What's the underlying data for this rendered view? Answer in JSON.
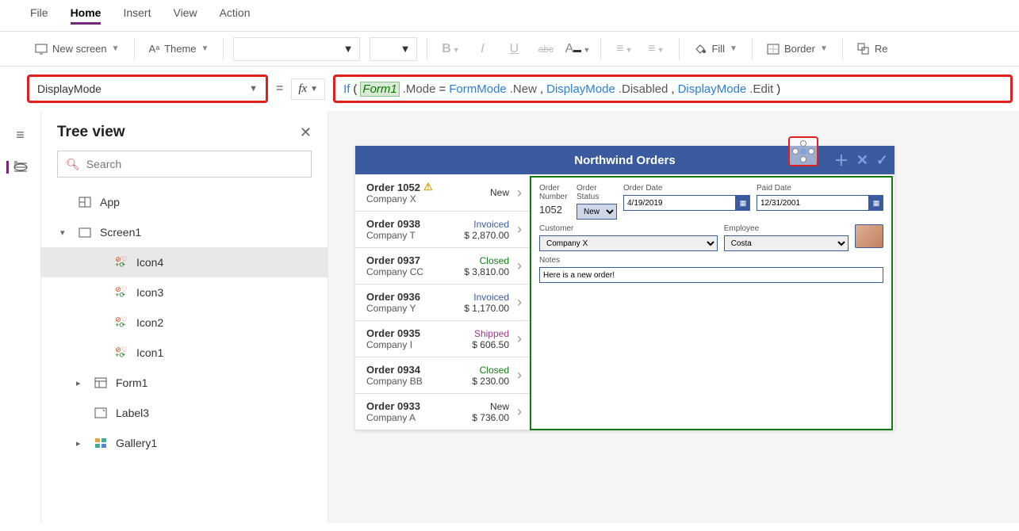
{
  "menubar": {
    "items": [
      "File",
      "Home",
      "Insert",
      "View",
      "Action"
    ],
    "active": 1
  },
  "toolbar": {
    "new_screen": "New screen",
    "theme": "Theme",
    "fill": "Fill",
    "border": "Border",
    "re": "Re"
  },
  "property": {
    "selected": "DisplayMode"
  },
  "formula": {
    "tokens": [
      {
        "t": "fn",
        "v": "If"
      },
      {
        "t": "punc",
        "v": "( "
      },
      {
        "t": "id",
        "v": "Form1"
      },
      {
        "t": "prop",
        "v": ".Mode"
      },
      {
        "t": "punc",
        "v": " = "
      },
      {
        "t": "enum",
        "v": "FormMode"
      },
      {
        "t": "prop",
        "v": ".New"
      },
      {
        "t": "punc",
        "v": ", "
      },
      {
        "t": "enum",
        "v": "DisplayMode"
      },
      {
        "t": "prop",
        "v": ".Disabled"
      },
      {
        "t": "punc",
        "v": ", "
      },
      {
        "t": "enum",
        "v": "DisplayMode"
      },
      {
        "t": "prop",
        "v": ".Edit"
      },
      {
        "t": "punc",
        "v": " )"
      }
    ]
  },
  "tree": {
    "title": "Tree view",
    "search_placeholder": "Search",
    "items": [
      {
        "depth": 1,
        "icon": "app",
        "label": "App"
      },
      {
        "depth": 1,
        "icon": "screen",
        "label": "Screen1",
        "expanded": true
      },
      {
        "depth": 3,
        "icon": "comp",
        "label": "Icon4",
        "selected": true
      },
      {
        "depth": 3,
        "icon": "comp",
        "label": "Icon3"
      },
      {
        "depth": 3,
        "icon": "comp",
        "label": "Icon2"
      },
      {
        "depth": 3,
        "icon": "comp",
        "label": "Icon1"
      },
      {
        "depth": 2,
        "icon": "form",
        "label": "Form1",
        "expandable": true
      },
      {
        "depth": 2,
        "icon": "label",
        "label": "Label3"
      },
      {
        "depth": 2,
        "icon": "gallery",
        "label": "Gallery1",
        "expandable": true
      }
    ]
  },
  "app": {
    "title": "Northwind Orders",
    "orders": [
      {
        "name": "Order 1052",
        "company": "Company X",
        "status": "New",
        "statusClass": "st-new",
        "amt": "",
        "warn": true
      },
      {
        "name": "Order 0938",
        "company": "Company T",
        "status": "Invoiced",
        "statusClass": "st-invoiced",
        "amt": "$ 2,870.00"
      },
      {
        "name": "Order 0937",
        "company": "Company CC",
        "status": "Closed",
        "statusClass": "st-closed",
        "amt": "$ 3,810.00"
      },
      {
        "name": "Order 0936",
        "company": "Company Y",
        "status": "Invoiced",
        "statusClass": "st-invoiced",
        "amt": "$ 1,170.00"
      },
      {
        "name": "Order 0935",
        "company": "Company I",
        "status": "Shipped",
        "statusClass": "st-shipped",
        "amt": "$ 606.50"
      },
      {
        "name": "Order 0934",
        "company": "Company BB",
        "status": "Closed",
        "statusClass": "st-closed",
        "amt": "$ 230.00"
      },
      {
        "name": "Order 0933",
        "company": "Company A",
        "status": "New",
        "statusClass": "st-new",
        "amt": "$ 736.00"
      }
    ],
    "form": {
      "labels": {
        "order_number": "Order Number",
        "order_status": "Order Status",
        "order_date": "Order Date",
        "paid_date": "Paid Date",
        "customer": "Customer",
        "employee": "Employee",
        "notes": "Notes"
      },
      "values": {
        "order_number": "1052",
        "order_status": "New",
        "order_date": "4/19/2019",
        "paid_date": "12/31/2001",
        "customer": "Company X",
        "employee": "Costa",
        "notes": "Here is a new order!"
      }
    }
  }
}
